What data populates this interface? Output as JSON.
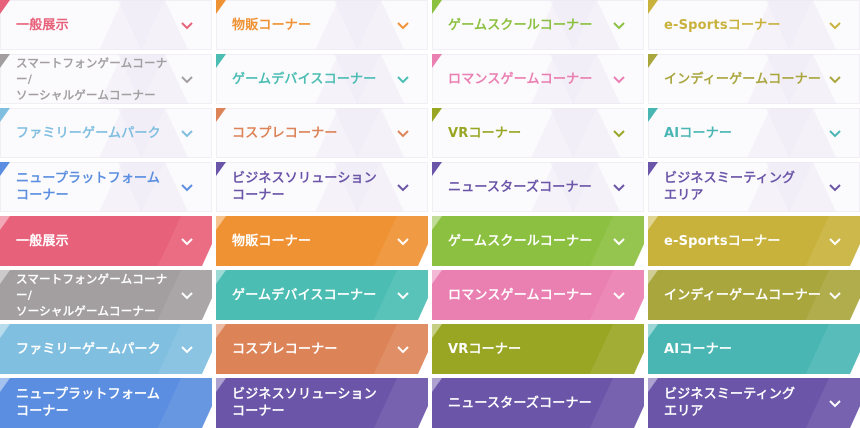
{
  "labels": {
    "general": "一般展示",
    "merch": "物販コーナー",
    "school": "ゲームスクールコーナー",
    "esports": "e-Sportsコーナー",
    "smartphone": "スマートフォンゲームコーナー/\nソーシャルゲームコーナー",
    "device": "ゲームデバイスコーナー",
    "romance": "ロマンスゲームコーナー",
    "indie": "インディーゲームコーナー",
    "family": "ファミリーゲームパーク",
    "cosplay": "コスプレコーナー",
    "vr": "VRコーナー",
    "ai": "AIコーナー",
    "platform": "ニュープラットフォーム\nコーナー",
    "business_solution": "ビジネスソリューション\nコーナー",
    "new_stars": "ニュースターズコーナー",
    "business_meeting": "ビジネスミーティング\nエリア"
  },
  "colors": {
    "general": "#e8617a",
    "merch": "#ef9234",
    "school": "#8cc040",
    "esports": "#c9b23c",
    "smartphone": "#a39fa0",
    "device": "#4bbdb3",
    "romance": "#ea7fb1",
    "indie": "#aaa63e",
    "family": "#80bfdf",
    "cosplay": "#dc8458",
    "vr": "#99a624",
    "ai": "#4ab6b4",
    "platform": "#5b8ee0",
    "business_solution": "#6b55a8",
    "new_stars": "#6b55a8",
    "business_meeting": "#6b55a8"
  },
  "icons": {
    "chevron": "chevron-down-icon"
  }
}
